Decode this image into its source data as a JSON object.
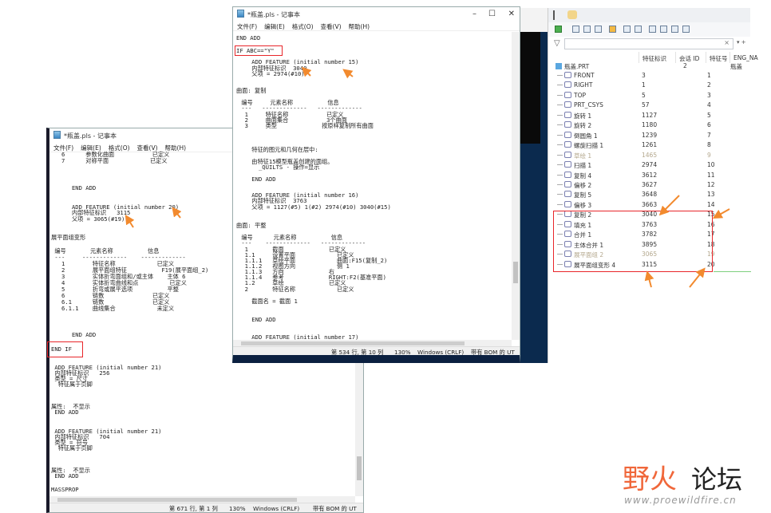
{
  "back_notepad": {
    "title": "*瓶盖.pls - 记事本",
    "menu": [
      "文件(F)",
      "编辑(E)",
      "格式(O)",
      "查看(V)",
      "帮助(H)"
    ],
    "lines": [
      "   6      参数化曲面           已定义",
      "   7      对称平面            已定义",
      "      END ADD",
      "      ADD FEATURE (initial number 20)",
      "      内部特征标识   3115",
      "      父项 = 3065(#19)",
      "展平面组变形",
      " 编号       元素名称          信息",
      " ---     -------------    -------------",
      "   1        特征名称            已定义",
      "   2        展平面组特征          F19(展平面组_2)",
      "   3        实体折弯面组和/或主体    主体 6",
      "   4        实体折弯曲线和点         已定义",
      "   5        折弯或展平选项          平整",
      "   6        链数              已定义",
      "   6.1      链数              已定义",
      "   6.1.1    曲线集合            未定义",
      "      END ADD",
      "END IF",
      " ADD FEATURE (initial number 21)",
      " 内部特征标识   256",
      " 类型 = 尺寸",
      "  特征属于页脚",
      "属性:  不显示",
      " END ADD",
      " ADD FEATURE (initial number 21)",
      " 内部特征标识   704",
      " 类型 = 符号",
      "  特征属于页脚",
      "属性:  不显示",
      " END ADD",
      "MASSPROP"
    ],
    "status": {
      "position": "第 671 行, 第 1 列",
      "zoom": "130%",
      "line_ending": "Windows (CRLF)",
      "encoding": "带有 BOM 的 UT"
    }
  },
  "front_notepad": {
    "title": "*瓶盖.pls - 记事本",
    "menu": [
      "文件(F)",
      "编辑(E)",
      "格式(O)",
      "查看(V)",
      "帮助(H)"
    ],
    "lines": [
      "END ADD",
      "IF ABC==\"Y\"",
      "    ADD FEATURE (initial number 15)",
      "    内部特征标识  3040",
      "    父项 = 2974(#10)",
      "曲面: 复制",
      " 编号     元素名称          信息",
      " ---   -------------   -------------",
      "  1     特征名称           已定义",
      "  2     曲面集合           3个曲面",
      "  3     类型             按原样复制所有曲面",
      "    特征的图元和几何在层中:",
      "    由特征15模型瓶盖创建的面组。",
      "      _QUILTS - 操作=显示",
      "    END ADD",
      "    ADD FEATURE (initial number 16)",
      "    内部特征标识  3763",
      "    父项 = 1127(#5) 1(#2) 2974(#10) 3040(#15)",
      "曲面: 平整",
      " 编号      元素名称          信息",
      " ---    -------------   -------------",
      "  1       截面             已定义",
      "  1.1     设置平面            已定义",
      "  1.1.1   草绘平面            曲面:F15(复制_2)",
      "  1.1.2   视图方向            侧 1",
      "  1.1.3   方向             右",
      "  1.1.4   参考             RIGHT:F2(基准平面)",
      "  1.2     草绘             已定义",
      "  2       特征名称            已定义",
      "    截面名 = 截面 1",
      "    END ADD",
      "    ADD FEATURE (initial number 17)"
    ],
    "status": {
      "position": "第 534 行, 第 10 列",
      "zoom": "130%",
      "line_ending": "Windows (CRLF)",
      "encoding": "带有 BOM 的 UT"
    }
  },
  "model_tree": {
    "search_clear": "×",
    "columns": [
      "特征标识",
      "会话 ID",
      "特征号",
      "ENG_NA"
    ],
    "root": {
      "name": "瓶盖.PRT",
      "session_id": "2",
      "eng_name": "瓶盖"
    },
    "rows": [
      {
        "name": "FRONT",
        "id": "3",
        "no": "1"
      },
      {
        "name": "RIGHT",
        "id": "1",
        "no": "2"
      },
      {
        "name": "TOP",
        "id": "5",
        "no": "3"
      },
      {
        "name": "PRT_CSYS",
        "id": "57",
        "no": "4"
      },
      {
        "name": "旋转 1",
        "id": "1127",
        "no": "5"
      },
      {
        "name": "旋转 2",
        "id": "1180",
        "no": "6"
      },
      {
        "name": "倒圆角 1",
        "id": "1239",
        "no": "7"
      },
      {
        "name": "螺旋扫描 1",
        "id": "1261",
        "no": "8"
      },
      {
        "name": "草绘 1",
        "id": "1465",
        "no": "9",
        "dim": true
      },
      {
        "name": "扫描 1",
        "id": "2974",
        "no": "10"
      },
      {
        "name": "复制 4",
        "id": "3612",
        "no": "11"
      },
      {
        "name": "偏移 2",
        "id": "3627",
        "no": "12"
      },
      {
        "name": "复制 5",
        "id": "3648",
        "no": "13"
      },
      {
        "name": "偏移 3",
        "id": "3663",
        "no": "14"
      },
      {
        "name": "复制 2",
        "id": "3040",
        "no": "15"
      },
      {
        "name": "填充 1",
        "id": "3763",
        "no": "16"
      },
      {
        "name": "合并 1",
        "id": "3782",
        "no": "17"
      },
      {
        "name": "主体合并 1",
        "id": "3895",
        "no": "18"
      },
      {
        "name": "展平面组 2",
        "id": "3065",
        "no": "19",
        "dim": true
      },
      {
        "name": "展平面组变形 4",
        "id": "3115",
        "no": "20"
      }
    ]
  },
  "watermark": {
    "brand_orange": "野火",
    "brand_black": "论坛",
    "url": "www.proewildfire.cn"
  },
  "colors": {
    "highlight": "#e8262a",
    "arrow": "#f28a2e"
  }
}
